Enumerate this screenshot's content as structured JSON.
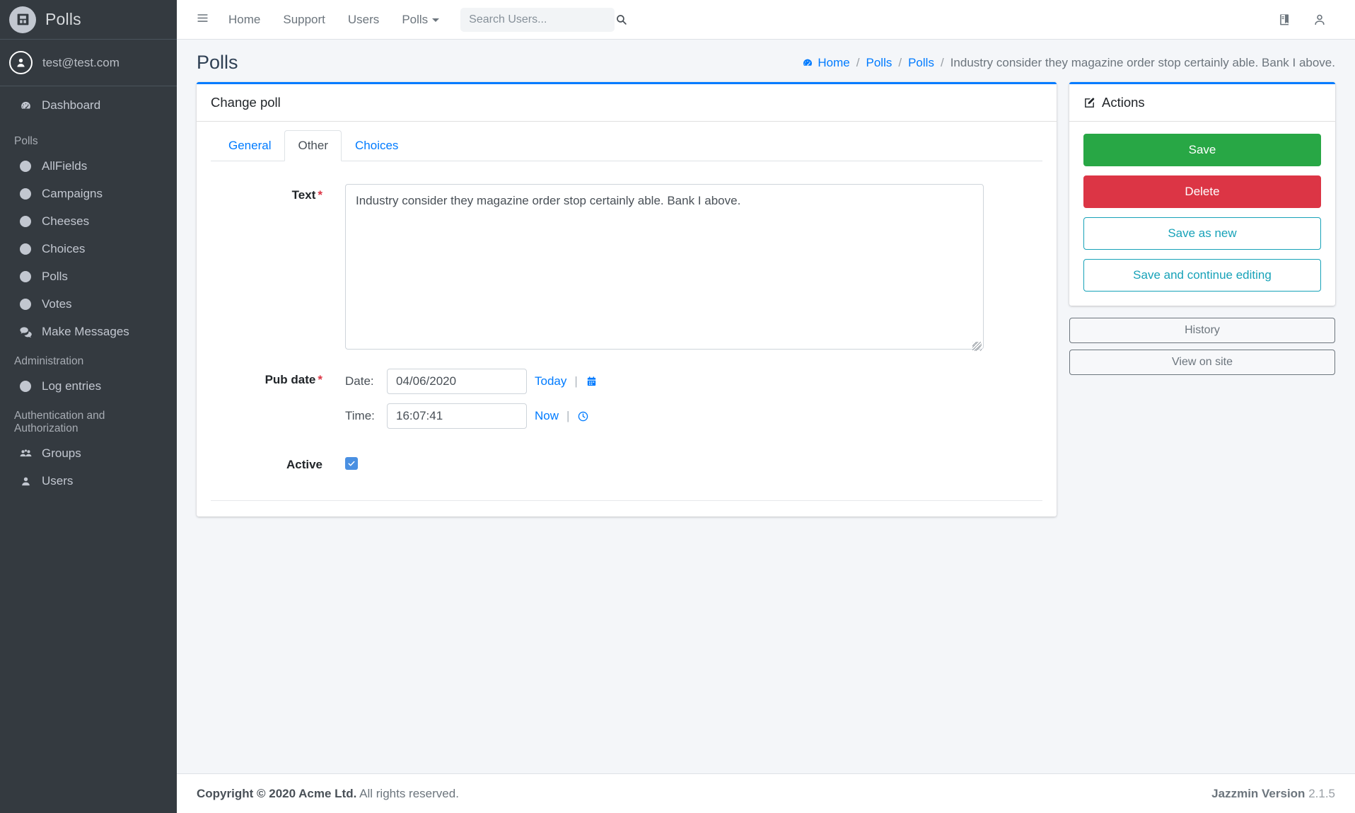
{
  "sidebar": {
    "brand": {
      "label": "Polls",
      "icon": "app-logo-icon"
    },
    "user": {
      "email": "test@test.com",
      "icon": "user-circle-icon"
    },
    "dashboard": {
      "label": "Dashboard",
      "icon": "dashboard-icon"
    },
    "groups": [
      {
        "header": "Polls",
        "items": [
          {
            "label": "AllFields",
            "icon": "circle-icon"
          },
          {
            "label": "Campaigns",
            "icon": "circle-icon"
          },
          {
            "label": "Cheeses",
            "icon": "circle-icon"
          },
          {
            "label": "Choices",
            "icon": "circle-icon"
          },
          {
            "label": "Polls",
            "icon": "circle-icon"
          },
          {
            "label": "Votes",
            "icon": "circle-icon"
          },
          {
            "label": "Make Messages",
            "icon": "comments-icon"
          }
        ]
      },
      {
        "header": "Administration",
        "items": [
          {
            "label": "Log entries",
            "icon": "circle-icon"
          }
        ]
      },
      {
        "header": "Authentication and Authorization",
        "items": [
          {
            "label": "Groups",
            "icon": "users-group-icon"
          },
          {
            "label": "Users",
            "icon": "user-icon"
          }
        ]
      }
    ]
  },
  "navbar": {
    "burger_icon": "hamburger-icon",
    "links": [
      "Home",
      "Support",
      "Users"
    ],
    "dropdown": {
      "label": "Polls",
      "icon": "caret-down-icon"
    },
    "search": {
      "placeholder": "Search Users...",
      "value": "",
      "icon": "search-icon"
    },
    "right_icons": [
      "book-icon",
      "user-icon"
    ]
  },
  "header": {
    "page_title": "Polls",
    "breadcrumb": {
      "home": "Home",
      "home_icon": "dashboard-icon",
      "items": [
        "Polls",
        "Polls"
      ],
      "current": "Industry consider they magazine order stop certainly able. Bank I above.",
      "separator": "/"
    }
  },
  "main_card": {
    "title": "Change poll",
    "tabs": [
      {
        "label": "General",
        "active": false
      },
      {
        "label": "Other",
        "active": true
      },
      {
        "label": "Choices",
        "active": false
      }
    ],
    "fields": {
      "text": {
        "label": "Text",
        "required_marker": "*",
        "value": "Industry consider they magazine order stop certainly able. Bank I above."
      },
      "pub_date": {
        "label": "Pub date",
        "required_marker": "*",
        "date_label": "Date:",
        "date_value": "04/06/2020",
        "date_shortcut": "Today",
        "date_icon": "calendar-icon",
        "time_label": "Time:",
        "time_value": "16:07:41",
        "time_shortcut": "Now",
        "time_icon": "clock-icon",
        "pipe": "|"
      },
      "active": {
        "label": "Active",
        "checked": true,
        "icon": "check-icon"
      }
    }
  },
  "actions": {
    "title": "Actions",
    "icon": "edit-pencil-icon",
    "buttons": [
      {
        "label": "Save",
        "style": "save"
      },
      {
        "label": "Delete",
        "style": "delete"
      },
      {
        "label": "Save as new",
        "style": "outline"
      },
      {
        "label": "Save and continue editing",
        "style": "outline"
      }
    ],
    "secondary_buttons": [
      {
        "label": "History"
      },
      {
        "label": "View on site"
      }
    ]
  },
  "footer": {
    "copyright_bold": "Copyright © 2020 Acme Ltd.",
    "copyright_rest": "All rights reserved.",
    "version_label": "Jazzmin Version",
    "version_number": "2.1.5"
  },
  "colors": {
    "accent": "#007bff",
    "sidebar_bg": "#343a40",
    "save": "#28a745",
    "delete": "#dc3545",
    "outline": "#17a2b8",
    "body_bg": "#f4f6f9"
  }
}
